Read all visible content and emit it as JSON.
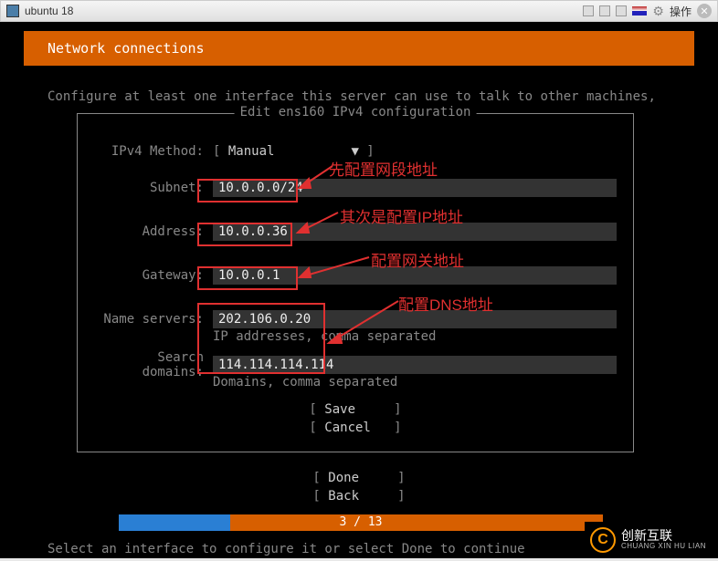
{
  "vm": {
    "title": "ubuntu 18",
    "action_label": "操作"
  },
  "header": {
    "title": "Network connections"
  },
  "instruction_top": "Configure at least one interface this server can use to talk to other machines,",
  "config": {
    "box_title": " Edit ens160 IPv4 configuration ",
    "method_label": "IPv4 Method:",
    "method_value": "Manual",
    "subnet_label": "Subnet:",
    "subnet_value": "10.0.0.0/24",
    "address_label": "Address:",
    "address_value": "10.0.0.36",
    "gateway_label": "Gateway:",
    "gateway_value": "10.0.0.1",
    "ns_label": "Name servers:",
    "ns_value": "202.106.0.20",
    "ns_hint": "IP addresses, comma separated",
    "sd_label": "Search domains:",
    "sd_value": "114.114.114.114",
    "sd_hint": "Domains, comma separated",
    "save_label": "Save",
    "cancel_label": "Cancel"
  },
  "bottom": {
    "done_label": "Done",
    "back_label": "Back"
  },
  "progress": {
    "text": "3 / 13",
    "current": 3,
    "total": 13
  },
  "instruction_bottom": "Select an interface to configure it or select Done to continue",
  "annotations": {
    "a1": "先配置网段地址",
    "a2": "其次是配置IP地址",
    "a3": "配置网关地址",
    "a4": "配置DNS地址"
  },
  "watermark": {
    "logo_letter": "C",
    "line1": "创新互联",
    "line2": "CHUANG XIN HU LIAN"
  }
}
